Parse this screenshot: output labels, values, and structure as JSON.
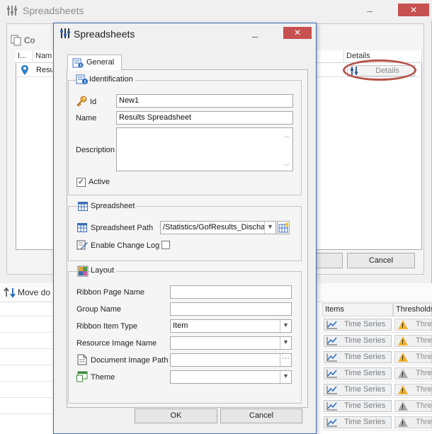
{
  "background": {
    "title": "Spreadsheets",
    "copy_label": "Co",
    "grid_headers": [
      "I...",
      "Nam",
      "Details"
    ],
    "row_name": "Resu",
    "details_button": "Details",
    "cancel_button": "Cancel",
    "move_label": "Move do",
    "lower_headers": [
      "Items",
      "Thresholds"
    ],
    "lower_rows": [
      {
        "items": "Time Series",
        "threshold": "Thre",
        "warn": "orange"
      },
      {
        "items": "Time Series",
        "threshold": "Thre",
        "warn": "orange"
      },
      {
        "items": "Time Series",
        "threshold": "Thre",
        "warn": "orange"
      },
      {
        "items": "Time Series",
        "threshold": "Thre",
        "warn": "grey"
      },
      {
        "items": "Time Series",
        "threshold": "Thre",
        "warn": "orange"
      },
      {
        "items": "Time Series",
        "threshold": "Thre",
        "warn": "grey"
      },
      {
        "items": "Time Series",
        "threshold": "Thre",
        "warn": "grey"
      }
    ]
  },
  "dialog": {
    "title": "Spreadsheets",
    "tab_general": "General",
    "identification": {
      "group_title": "Identification",
      "id_label": "Id",
      "id_value": "New1",
      "name_label": "Name",
      "name_value": "Results Spreadsheet",
      "description_label": "Description",
      "description_value": "",
      "active_label": "Active",
      "active_checked": true
    },
    "spreadsheet": {
      "group_title": "Spreadsheet",
      "path_label": "Spreadsheet Path",
      "path_value": "/Statistics/GofResults_Discha",
      "change_log_label": "Enable Change Log",
      "change_log_checked": false
    },
    "layout": {
      "group_title": "Layout",
      "ribbon_page_label": "Ribbon Page Name",
      "ribbon_page_value": "",
      "group_name_label": "Group Name",
      "group_name_value": "",
      "ribbon_item_type_label": "Ribbon Item Type",
      "ribbon_item_type_value": "Item",
      "resource_image_label": "Resource Image Name",
      "resource_image_value": "",
      "document_image_label": "Document Image Path",
      "document_image_value": "",
      "theme_label": "Theme",
      "theme_value": ""
    },
    "ok_button": "OK",
    "cancel_button": "Cancel"
  },
  "colors": {
    "close_button": "#c75050",
    "dialog_border": "#3c6cb2",
    "annotation_circle": "#b5534a",
    "warning": "#f2b22d"
  }
}
